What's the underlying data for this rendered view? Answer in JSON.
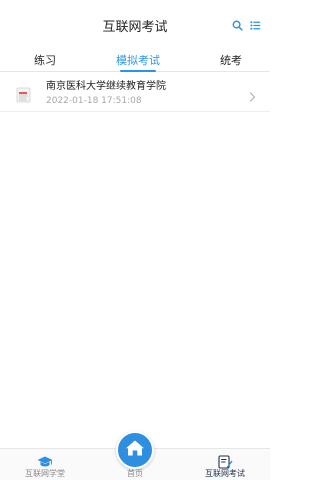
{
  "header": {
    "title": "互联网考试",
    "search_icon": "search-icon",
    "list_icon": "list-menu-icon"
  },
  "tabs": [
    {
      "label": "练习",
      "active": false
    },
    {
      "label": "模拟考试",
      "active": true
    },
    {
      "label": "统考",
      "active": false
    }
  ],
  "list": [
    {
      "title": "南京医科大学继续教育学院",
      "time": "2022-01-18 17:51:08",
      "icon": "document-icon"
    }
  ],
  "bottom_nav": [
    {
      "label": "互联网学堂",
      "icon": "graduation-cap-icon",
      "active": false
    },
    {
      "label": "首页",
      "icon": "home-icon",
      "active": false
    },
    {
      "label": "互联网考试",
      "icon": "exam-edit-icon",
      "active": true
    }
  ],
  "colors": {
    "accent": "#2a95e8",
    "home_fab": "#2e8fe0",
    "muted_text": "#a8a8a8"
  }
}
